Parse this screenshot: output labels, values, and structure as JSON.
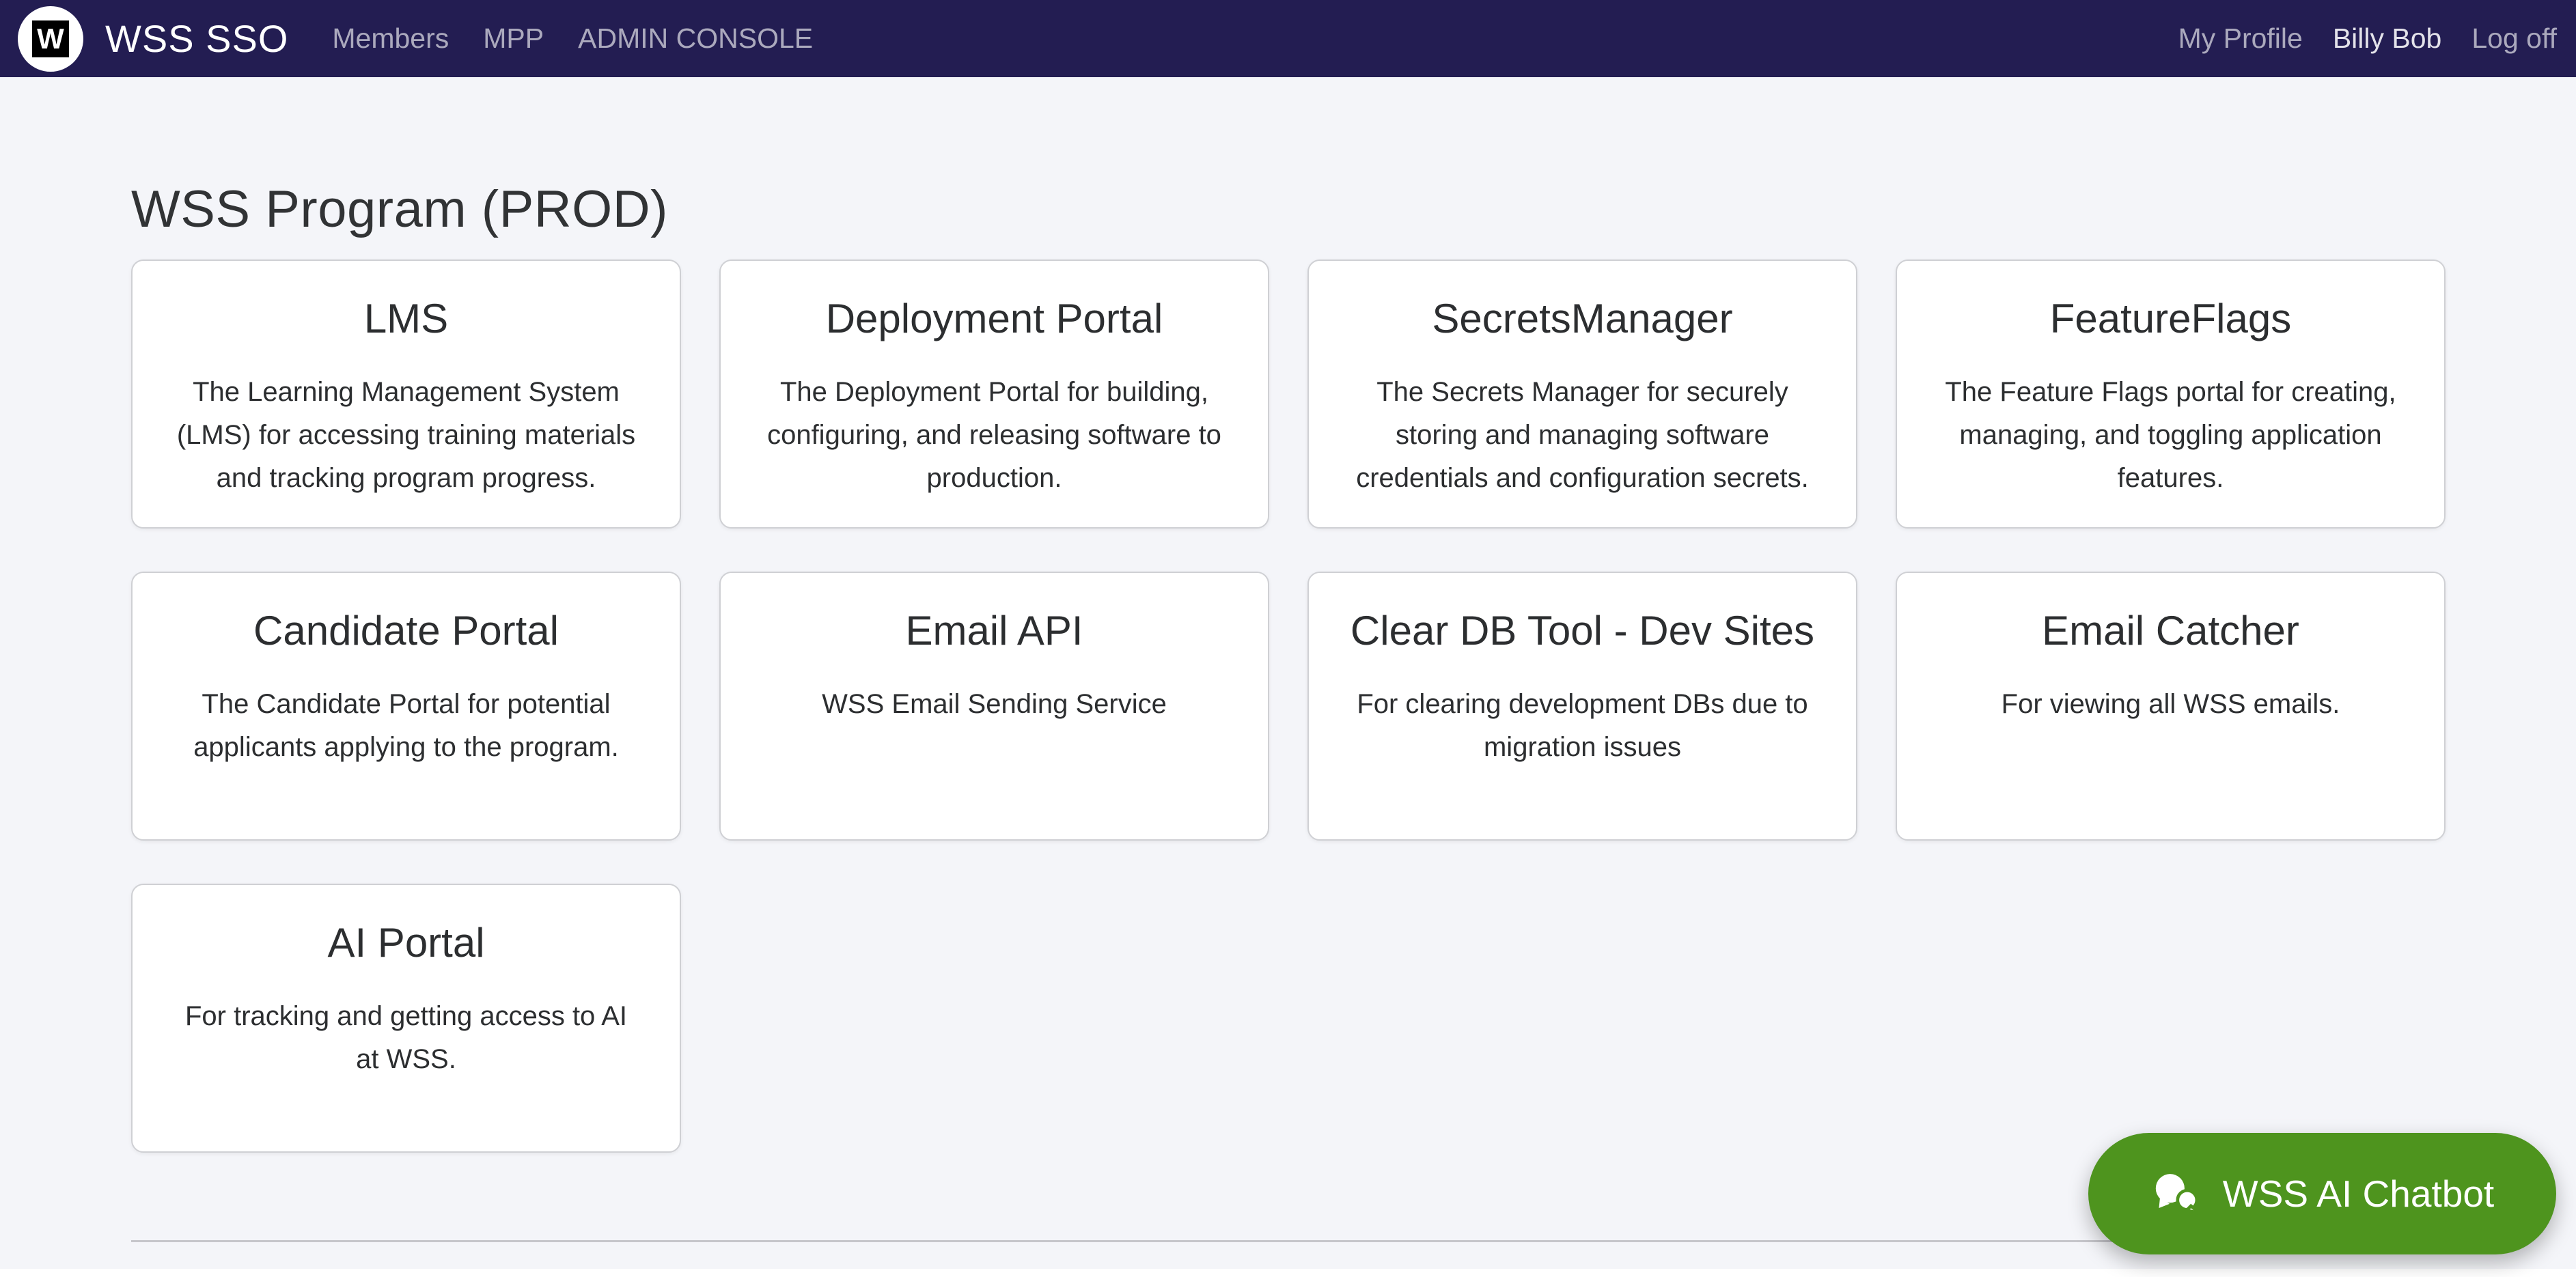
{
  "navbar": {
    "logo_letter": "W",
    "brand": "WSS SSO",
    "links_left": [
      {
        "label": "Members",
        "active": false
      },
      {
        "label": "MPP",
        "active": false
      },
      {
        "label": "ADMIN CONSOLE",
        "active": false
      }
    ],
    "links_right": [
      {
        "label": "My Profile",
        "active": false
      },
      {
        "label": "Billy Bob",
        "active": true
      },
      {
        "label": "Log off",
        "active": false
      }
    ]
  },
  "page": {
    "title": "WSS Program (PROD)"
  },
  "cards": [
    {
      "title": "LMS",
      "description": "The Learning Management System (LMS) for accessing training materials and tracking program progress."
    },
    {
      "title": "Deployment Portal",
      "description": "The Deployment Portal for building, configuring, and releasing software to production."
    },
    {
      "title": "SecretsManager",
      "description": "The Secrets Manager for securely storing and managing software credentials and configuration secrets."
    },
    {
      "title": "FeatureFlags",
      "description": "The Feature Flags portal for creating, managing, and toggling application features."
    },
    {
      "title": "Candidate Portal",
      "description": "The Candidate Portal for potential applicants applying to the program."
    },
    {
      "title": "Email API",
      "description": "WSS Email Sending Service"
    },
    {
      "title": "Clear DB Tool - Dev Sites",
      "description": "For clearing development DBs due to migration issues"
    },
    {
      "title": "Email Catcher",
      "description": "For viewing all WSS emails."
    },
    {
      "title": "AI Portal",
      "description": "For tracking and getting access to AI at WSS."
    }
  ],
  "chatbot": {
    "label": "WSS AI Chatbot",
    "icon": "chat-bubbles-icon"
  },
  "colors": {
    "navbar_bg": "#231d52",
    "page_bg": "#f4f5f9",
    "chatbot_green": "#4e941e",
    "card_border": "#cfd0d4"
  }
}
